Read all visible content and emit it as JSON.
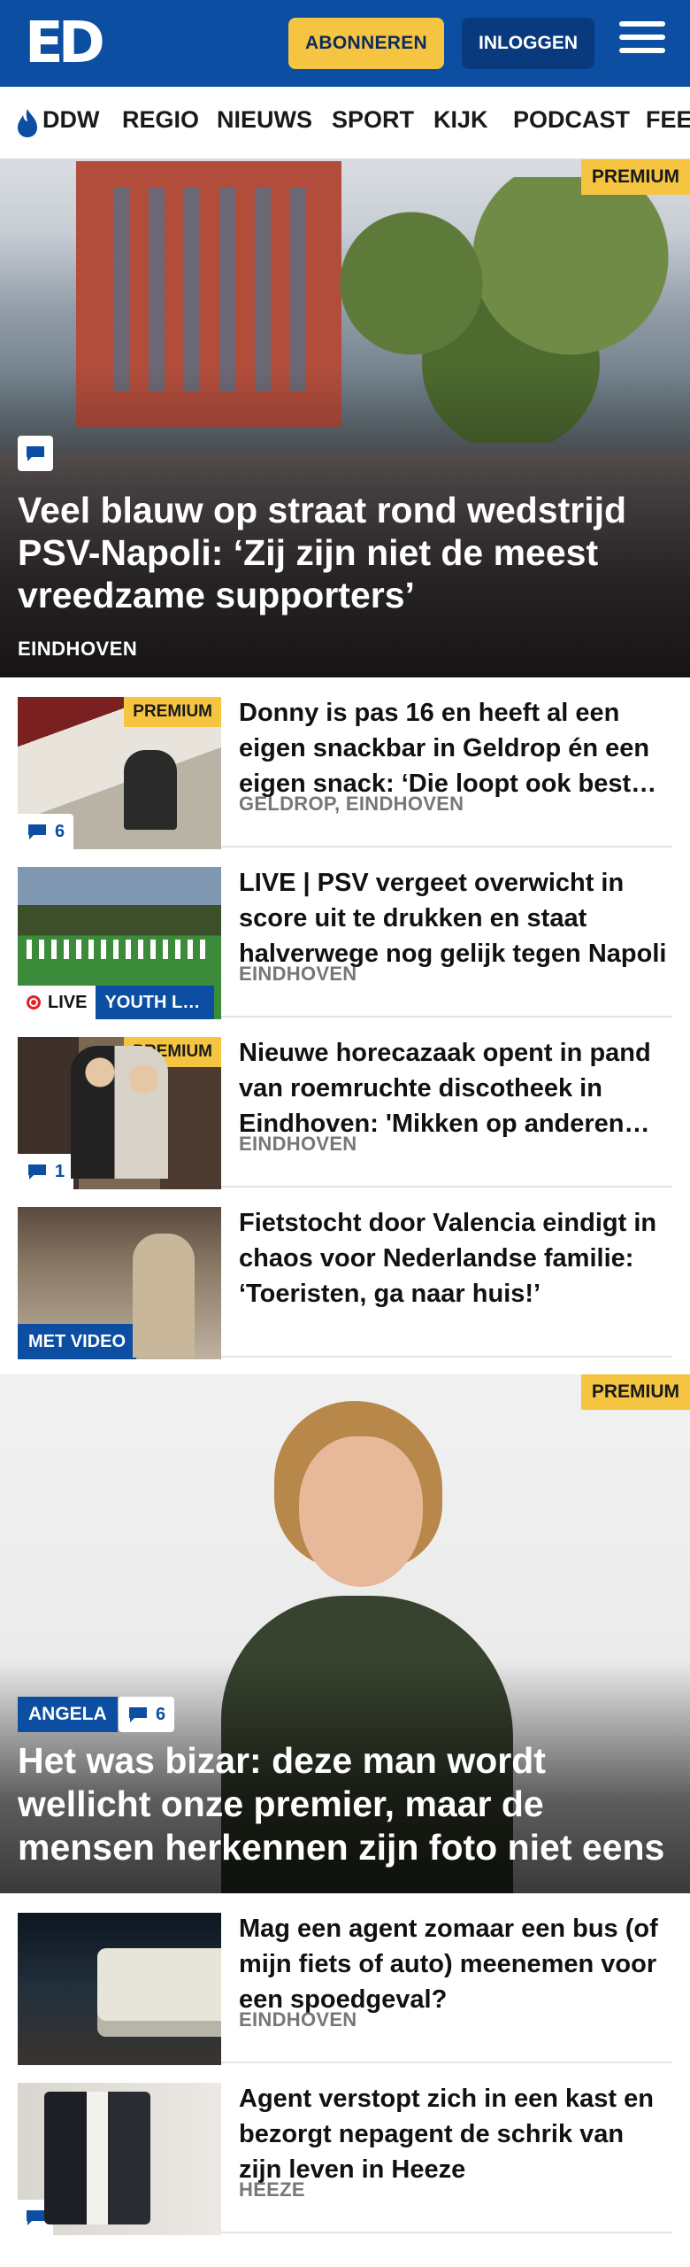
{
  "header": {
    "logo": "ED",
    "subscribe_label": "ABONNEREN",
    "login_label": "INLOGGEN",
    "brand_color": "#0b4ea2",
    "accent_color": "#f5c542"
  },
  "nav": {
    "items": [
      "DDW",
      "REGIO",
      "NIEUWS",
      "SPORT",
      "KIJK",
      "PODCAST",
      "FEE"
    ]
  },
  "hero": {
    "badge": "PREMIUM",
    "title": "Veel blauw op straat rond wedstrijd PSV-Napoli: ‘Zij zijn niet de meest vreedzame supporters’",
    "location": "EINDHOVEN"
  },
  "articles": [
    {
      "title": "Donny is pas 16 en heeft al een eigen snackbar in Geldrop én een eigen snack: ‘Die loopt ook best goed’",
      "location": "GELDROP, EINDHOVEN",
      "badge": "PREMIUM",
      "comments": "6"
    },
    {
      "title": "LIVE | PSV vergeet overwicht in score uit te drukken en staat halverwege nog gelijk tegen Napoli",
      "location": "EINDHOVEN",
      "live_label": "LIVE",
      "tag": "YOUTH LEAGUE"
    },
    {
      "title": "Nieuwe horecazaak opent in pand van roemruchte discotheek in Eindhoven: 'Mikken op anderen publiek'",
      "location": "EINDHOVEN",
      "badge": "PREMIUM",
      "comments": "1"
    },
    {
      "title": "Fietstocht door Valencia eindigt in chaos voor Nederlandse familie: ‘Toeristen, ga naar huis!’",
      "video_label": "MET VIDEO"
    }
  ],
  "feature": {
    "badge": "PREMIUM",
    "tag": "ANGELA",
    "comments": "6",
    "title": "Het was bizar: deze man wordt wellicht onze premier, maar de mensen herkennen zijn foto niet eens"
  },
  "articles2": [
    {
      "title": "Mag een agent zomaar een bus (of mijn fiets of auto) meenemen voor een spoedgeval?",
      "location": "EINDHOVEN"
    },
    {
      "title": "Agent verstopt zich in een kast en bezorgt nepagent de schrik van zijn leven in Heeze",
      "location": "HEEZE"
    }
  ]
}
